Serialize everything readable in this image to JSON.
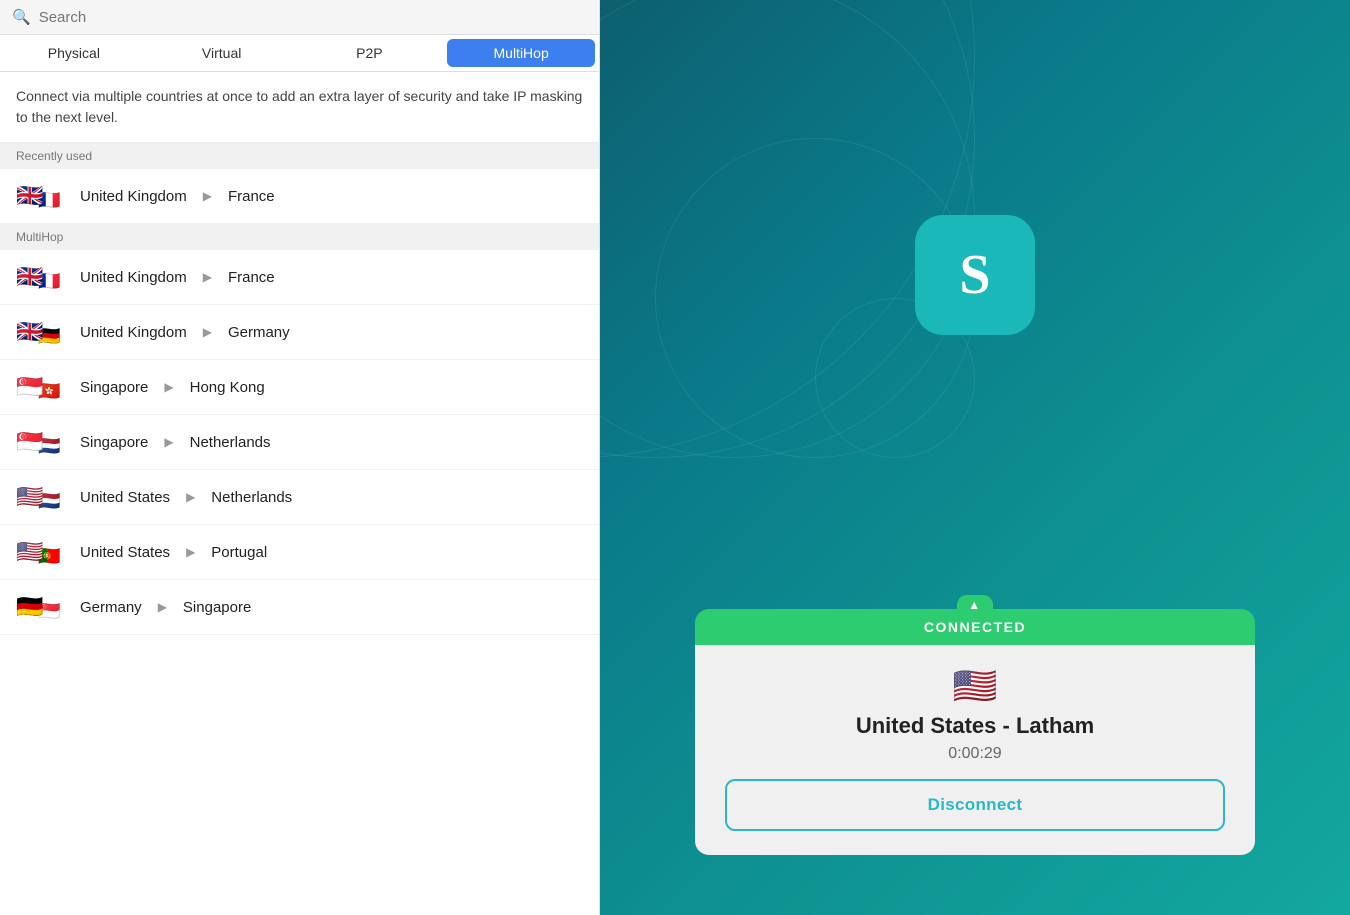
{
  "search": {
    "placeholder": "Search"
  },
  "tabs": [
    {
      "id": "physical",
      "label": "Physical",
      "active": false
    },
    {
      "id": "virtual",
      "label": "Virtual",
      "active": false
    },
    {
      "id": "p2p",
      "label": "P2P",
      "active": false
    },
    {
      "id": "multihop",
      "label": "MultiHop",
      "active": true
    }
  ],
  "description": "Connect via multiple countries at once to add an extra layer of security and take IP masking to the next level.",
  "recently_used_header": "Recently used",
  "multihop_header": "MultiHop",
  "recently_used": [
    {
      "from": "United Kingdom",
      "from_flag": "🇬🇧",
      "to": "France",
      "to_flag": "🇫🇷"
    }
  ],
  "multihop_items": [
    {
      "from": "United Kingdom",
      "from_flag": "🇬🇧",
      "to": "France",
      "to_flag": "🇫🇷"
    },
    {
      "from": "United Kingdom",
      "from_flag": "🇬🇧",
      "to": "Germany",
      "to_flag": "🇩🇪"
    },
    {
      "from": "Singapore",
      "from_flag": "🇸🇬",
      "to": "Hong Kong",
      "to_flag": "🇭🇰"
    },
    {
      "from": "Singapore",
      "from_flag": "🇸🇬",
      "to": "Netherlands",
      "to_flag": "🇳🇱"
    },
    {
      "from": "United States",
      "from_flag": "🇺🇸",
      "to": "Netherlands",
      "to_flag": "🇳🇱"
    },
    {
      "from": "United States",
      "from_flag": "🇺🇸",
      "to": "Portugal",
      "to_flag": "🇵🇹"
    },
    {
      "from": "Germany",
      "from_flag": "🇩🇪",
      "to": "Singapore",
      "to_flag": "🇸🇬"
    }
  ],
  "connection": {
    "status": "CONNECTED",
    "location": "United States - Latham",
    "flag": "🇺🇸",
    "timer": "0:00:29",
    "disconnect_label": "Disconnect"
  },
  "logo_letter": "S"
}
